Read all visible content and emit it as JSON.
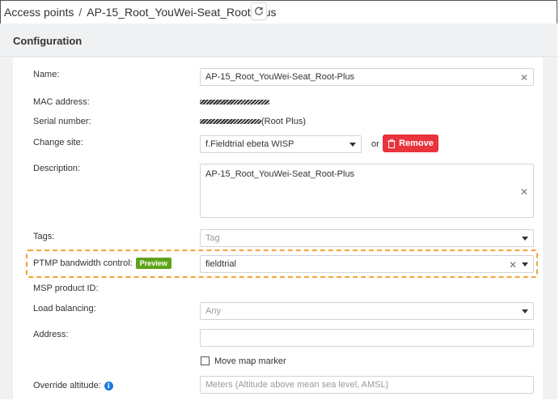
{
  "breadcrumb": {
    "parent": "Access points",
    "separator": "/",
    "current": "AP-15_Root_YouWei-Seat_Root-Plus"
  },
  "section_title": "Configuration",
  "fields": {
    "name": {
      "label": "Name:",
      "value": "AP-15_Root_YouWei-Seat_Root-Plus"
    },
    "mac": {
      "label": "MAC address:"
    },
    "serial": {
      "label": "Serial number:",
      "suffix": "(Root Plus)"
    },
    "site": {
      "label": "Change site:",
      "value": "f.Fieldtrial ebeta WISP",
      "or": "or",
      "remove_label": "Remove"
    },
    "description": {
      "label": "Description:",
      "value": "AP-15_Root_YouWei-Seat_Root-Plus"
    },
    "tags": {
      "label": "Tags:",
      "placeholder": "Tag"
    },
    "ptmp": {
      "label": "PTMP bandwidth control:",
      "badge": "Preview",
      "value": "fieldtrial"
    },
    "msp": {
      "label": "MSP product ID:"
    },
    "load_balancing": {
      "label": "Load balancing:",
      "value": "Any"
    },
    "address": {
      "label": "Address:",
      "value": ""
    },
    "move_marker": {
      "label": "Move map marker",
      "checked": false
    },
    "altitude": {
      "label": "Override altitude:",
      "placeholder": "Meters (Altitude above mean sea level, AMSL)"
    }
  },
  "colors": {
    "remove": "#e8343d",
    "badge": "#5fa31a",
    "highlight": "#f2a33b",
    "info": "#1e7be0"
  }
}
